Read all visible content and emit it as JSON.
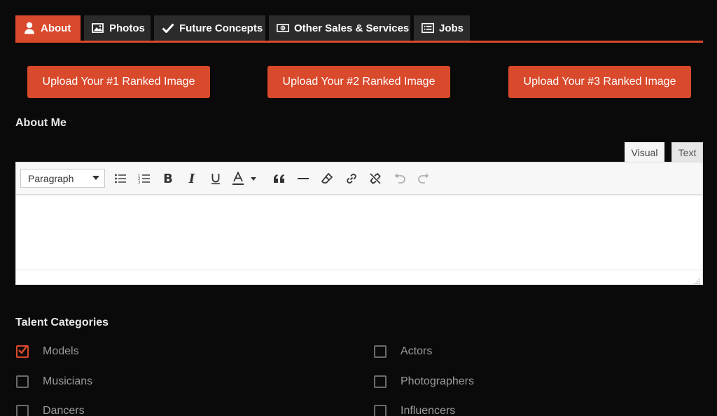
{
  "tabs": [
    {
      "label": "About",
      "icon": "user-icon",
      "active": true
    },
    {
      "label": "Photos",
      "icon": "photos-icon",
      "active": false
    },
    {
      "label": "Future Concepts",
      "icon": "checkmark-icon",
      "active": false
    },
    {
      "label": "Other Sales & Services",
      "icon": "money-icon",
      "active": false
    },
    {
      "label": "Jobs",
      "icon": "list-icon",
      "active": false
    }
  ],
  "uploads": [
    {
      "label": "Upload Your #1 Ranked Image"
    },
    {
      "label": "Upload Your #2 Ranked Image"
    },
    {
      "label": "Upload Your #3 Ranked Image"
    }
  ],
  "about": {
    "heading": "About Me",
    "editor": {
      "visual_tab": "Visual",
      "text_tab": "Text",
      "format_value": "Paragraph",
      "content": ""
    }
  },
  "talent": {
    "heading": "Talent Categories",
    "items": [
      {
        "label": "Models",
        "checked": true
      },
      {
        "label": "Actors",
        "checked": false
      },
      {
        "label": "Musicians",
        "checked": false
      },
      {
        "label": "Photographers",
        "checked": false
      },
      {
        "label": "Dancers",
        "checked": false
      },
      {
        "label": "Influencers",
        "checked": false
      }
    ]
  },
  "colors": {
    "accent": "#d9492b",
    "background": "#0a0a0a",
    "tab_inactive": "#2b2b2b"
  }
}
